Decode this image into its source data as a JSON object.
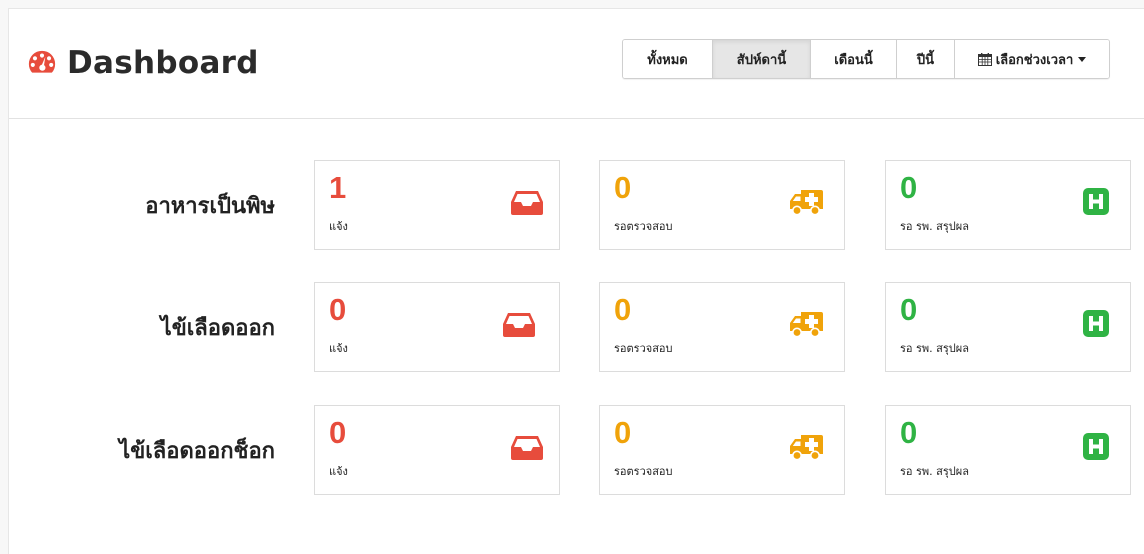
{
  "header": {
    "title": "Dashboard",
    "filters": [
      "ทั้งหมด",
      "สัปห์ดานี้",
      "เดือนนี้",
      "ปีนี้"
    ],
    "active_filter_index": 1,
    "date_range_label": "เลือกช่วงเวลา"
  },
  "rows": [
    {
      "label": "อาหารเป็นพิษ",
      "cards": [
        {
          "count": "1",
          "label": "แจ้ง"
        },
        {
          "count": "0",
          "label": "รอตรวจสอบ"
        },
        {
          "count": "0",
          "label": "รอ รพ. สรุปผล"
        }
      ]
    },
    {
      "label": "ไข้เลือดออก",
      "cards": [
        {
          "count": "0",
          "label": "แจ้ง"
        },
        {
          "count": "0",
          "label": "รอตรวจสอบ"
        },
        {
          "count": "0",
          "label": "รอ รพ. สรุปผล"
        }
      ]
    },
    {
      "label": "ไข้เลือดออกช็อก",
      "cards": [
        {
          "count": "0",
          "label": "แจ้ง"
        },
        {
          "count": "0",
          "label": "รอตรวจสอบ"
        },
        {
          "count": "0",
          "label": "รอ รพ. สรุปผล"
        }
      ]
    }
  ],
  "card_icons": [
    "inbox-icon",
    "ambulance-icon",
    "hospital-icon"
  ],
  "colors": {
    "title_icon": "#e74c3c",
    "reported": "#e74c3c",
    "pending": "#f0a30a",
    "hospital": "#2fb344"
  }
}
